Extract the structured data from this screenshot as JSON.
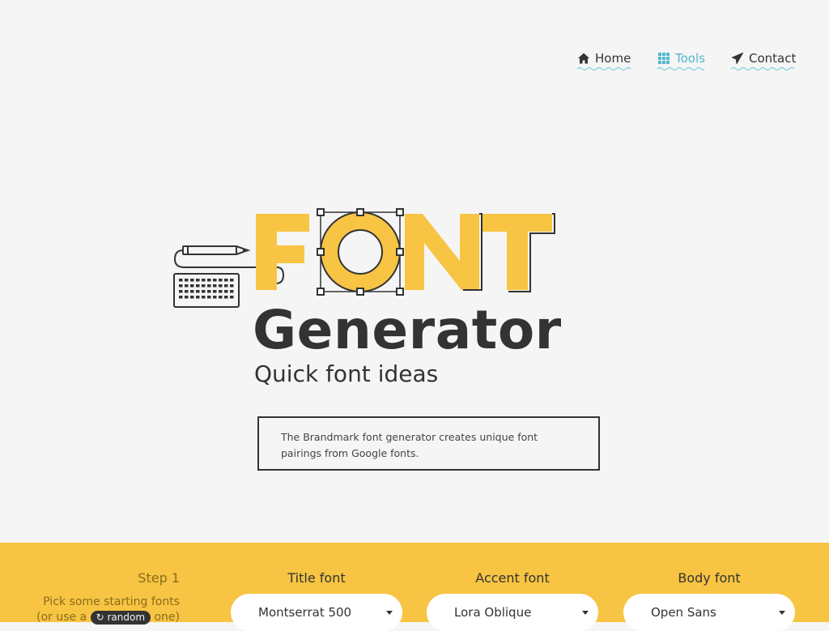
{
  "nav": {
    "items": [
      {
        "label": "Home",
        "icon": "home-icon"
      },
      {
        "label": "Tools",
        "icon": "grid-icon",
        "active": true
      },
      {
        "label": "Contact",
        "icon": "paper-plane-icon"
      }
    ],
    "active_color": "#4fb8cf"
  },
  "hero": {
    "logo_word": "FONT",
    "title": "Generator",
    "subtitle": "Quick font ideas",
    "description": "The Brandmark font generator creates unique font pairings from Google fonts."
  },
  "tool": {
    "step_label": "Step 1",
    "step_desc_pre": "Pick some starting fonts",
    "step_desc_mid": "(or use a",
    "random_label": "random",
    "step_desc_post": "one)",
    "columns": [
      {
        "heading": "Title font",
        "value": "Montserrat 500"
      },
      {
        "heading": "Accent font",
        "value": "Lora Oblique"
      },
      {
        "heading": "Body font",
        "value": "Open Sans"
      }
    ],
    "bar_color": "#f7c443"
  },
  "colors": {
    "accent_yellow": "#f7c443",
    "dark": "#333333",
    "background": "#f5f5f5"
  }
}
